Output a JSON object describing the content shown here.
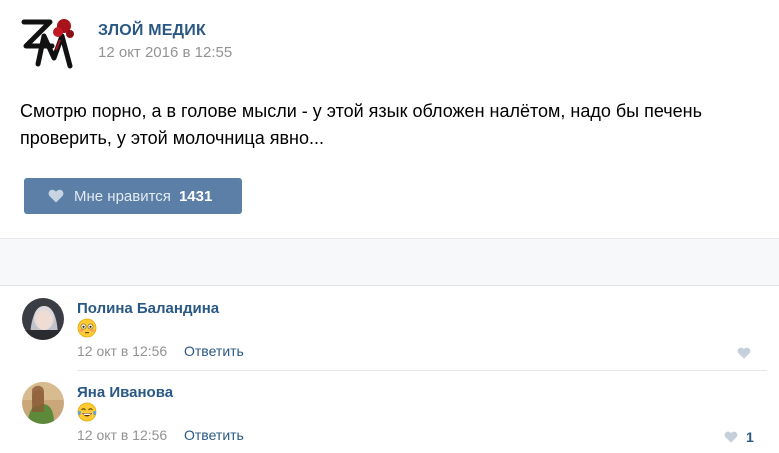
{
  "post": {
    "author": "ЗЛОЙ МЕДИК",
    "date": "12 окт 2016 в 12:55",
    "text": "Смотрю порно, а в голове мысли - у этой язык обложен налётом, надо бы печень проверить, у этой молочница явно...",
    "like_label": "Мне нравится",
    "like_count": "1431",
    "logo_icon": "zm-logo-icon"
  },
  "comments": [
    {
      "name": "Полина Баландина",
      "emoji": "flushed-face-emoji",
      "date": "12 окт в 12:56",
      "reply_label": "Ответить",
      "like_count": ""
    },
    {
      "name": "Яна Иванова",
      "emoji": "tears-of-joy-emoji",
      "date": "12 окт в 12:56",
      "reply_label": "Ответить",
      "like_count": "1"
    }
  ],
  "colors": {
    "link_blue": "#2a5885",
    "button_blue": "#5b7fa6",
    "meta_gray": "#939393"
  }
}
